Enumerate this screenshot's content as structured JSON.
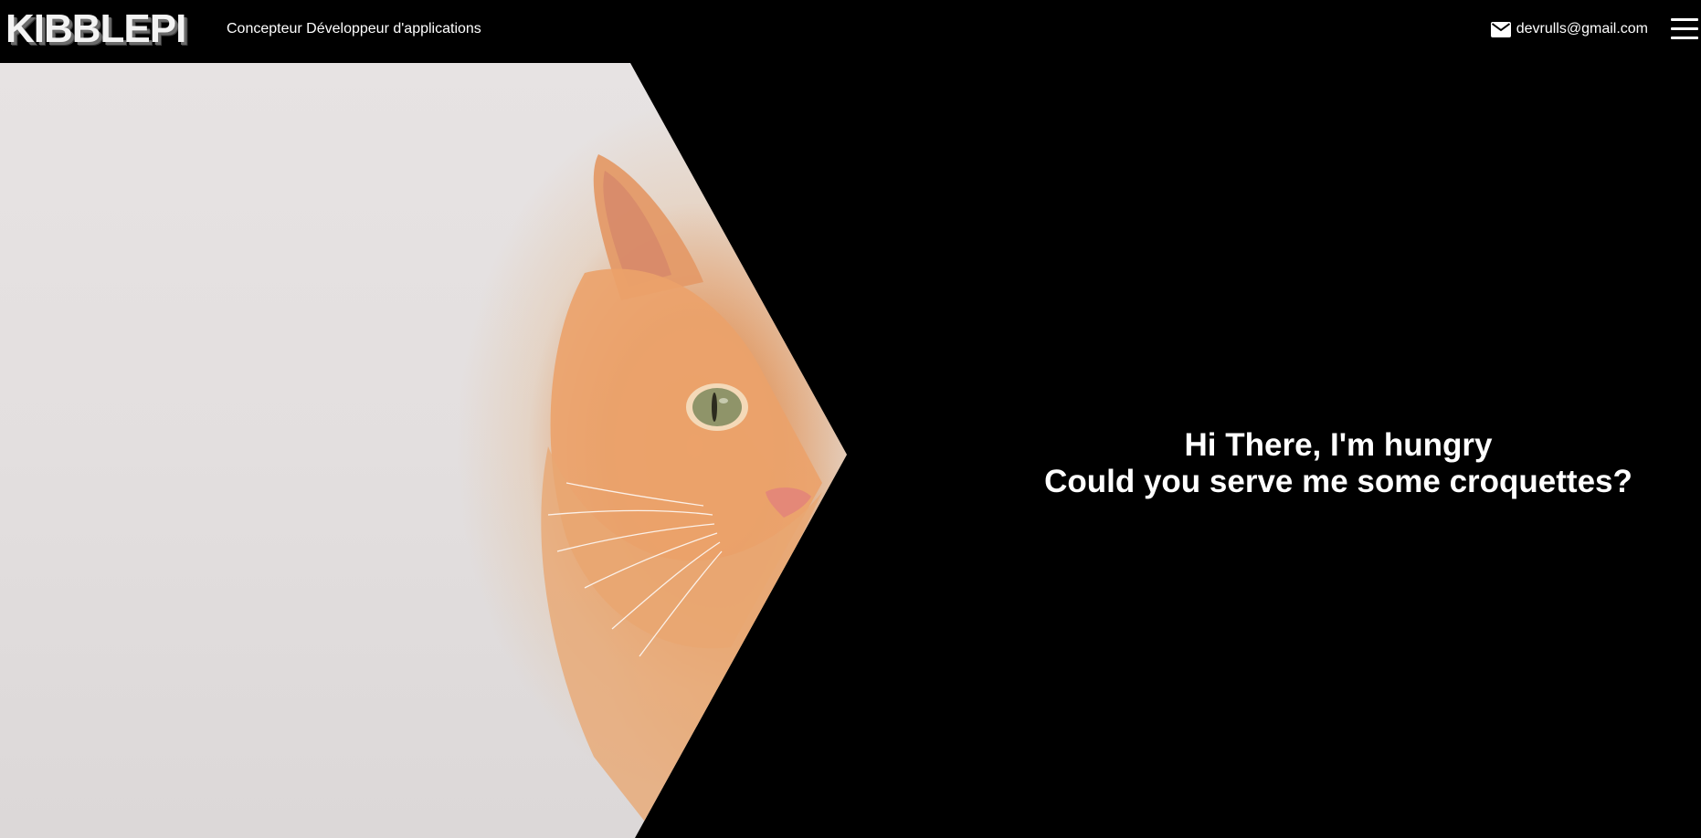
{
  "header": {
    "logo": "KIBBLEPI",
    "tagline": "Concepteur Développeur d'applications",
    "email": "devrulls@gmail.com",
    "email_icon": "mail-icon",
    "menu_icon": "hamburger-menu-icon"
  },
  "hero": {
    "image_subject": "orange tabby cat",
    "line1": "Hi There, I'm hungry",
    "line2": "Could you serve me some croquettes?"
  },
  "colors": {
    "background": "#000000",
    "text": "#ffffff",
    "photo_background": "#e5e1e1",
    "cat_fur": "#e79a5e"
  }
}
